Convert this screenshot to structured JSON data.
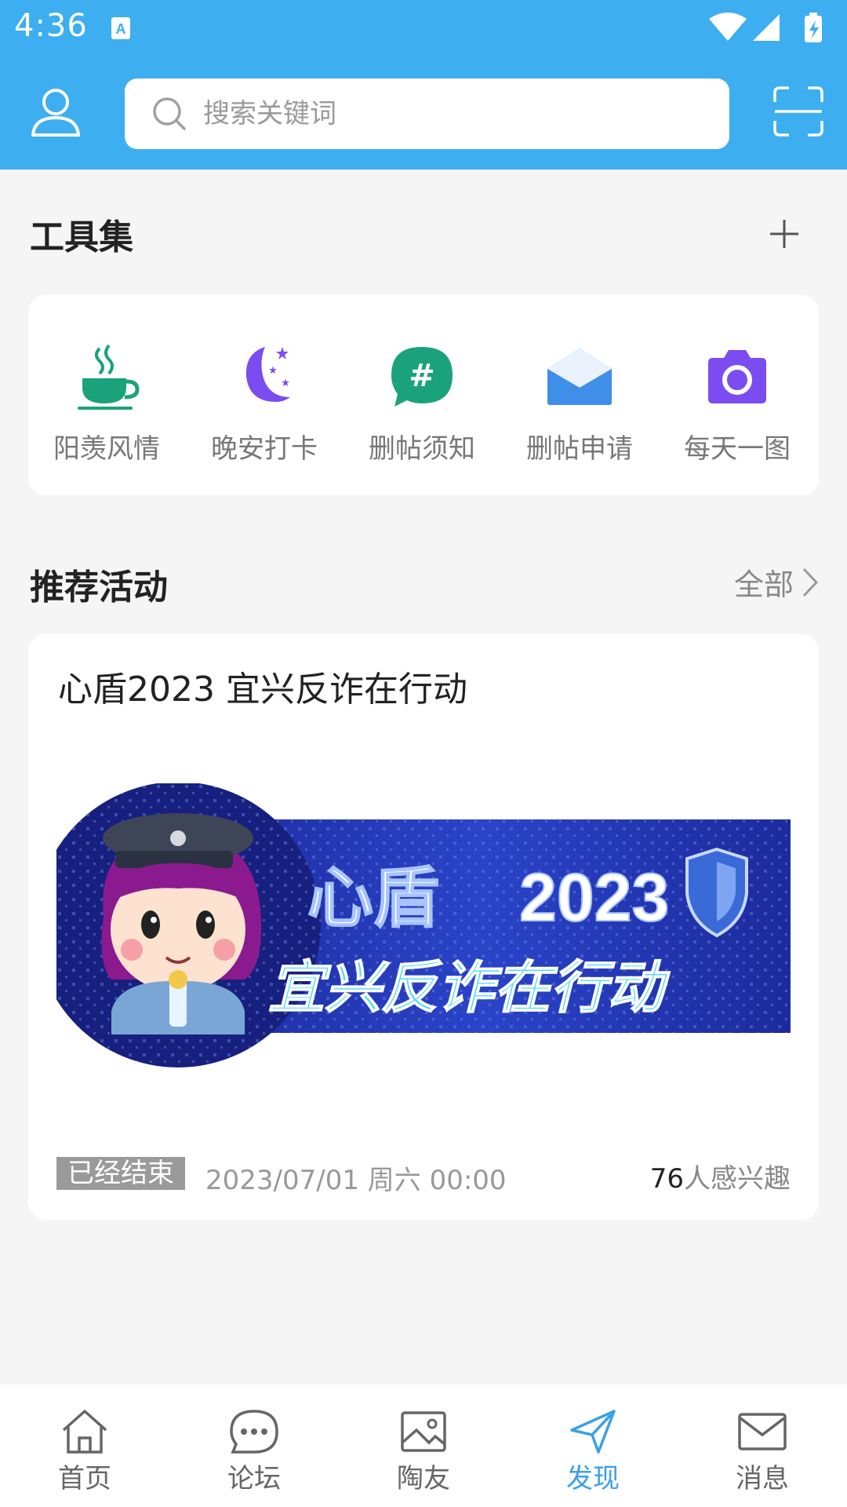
{
  "status_bar": {
    "time": "4:36"
  },
  "search": {
    "placeholder": "搜索关键词"
  },
  "tools_section": {
    "title": "工具集",
    "items": [
      {
        "label": "阳羡风情",
        "icon": "teacup-icon",
        "color": "#1aa37a"
      },
      {
        "label": "晚安打卡",
        "icon": "moon-stars-icon",
        "color": "#7b4cf0"
      },
      {
        "label": "删帖须知",
        "icon": "hashtag-chat-icon",
        "color": "#1aa37a"
      },
      {
        "label": "删帖申请",
        "icon": "mail-open-icon",
        "color": "#3f8ee8"
      },
      {
        "label": "每天一图",
        "icon": "camera-icon",
        "color": "#7b4cf0"
      }
    ]
  },
  "activities_section": {
    "title": "推荐活动",
    "all_label": "全部"
  },
  "activity": {
    "title": "心盾2023 宜兴反诈在行动",
    "banner": {
      "line1_a": "心盾",
      "line1_b": "2023",
      "line2": "宜兴反诈在行动"
    },
    "status": "已经结束",
    "date": "2023/07/01 周六 00:00",
    "interest_count": "76",
    "interest_suffix": "人感兴趣"
  },
  "bottom_nav": {
    "items": [
      {
        "label": "首页",
        "icon": "home-icon"
      },
      {
        "label": "论坛",
        "icon": "chat-bubble-icon"
      },
      {
        "label": "陶友",
        "icon": "image-icon"
      },
      {
        "label": "发现",
        "icon": "send-icon",
        "active": true
      },
      {
        "label": "消息",
        "icon": "envelope-icon"
      }
    ]
  },
  "colors": {
    "primary": "#3daef0",
    "active_nav": "#3aa0e8"
  }
}
